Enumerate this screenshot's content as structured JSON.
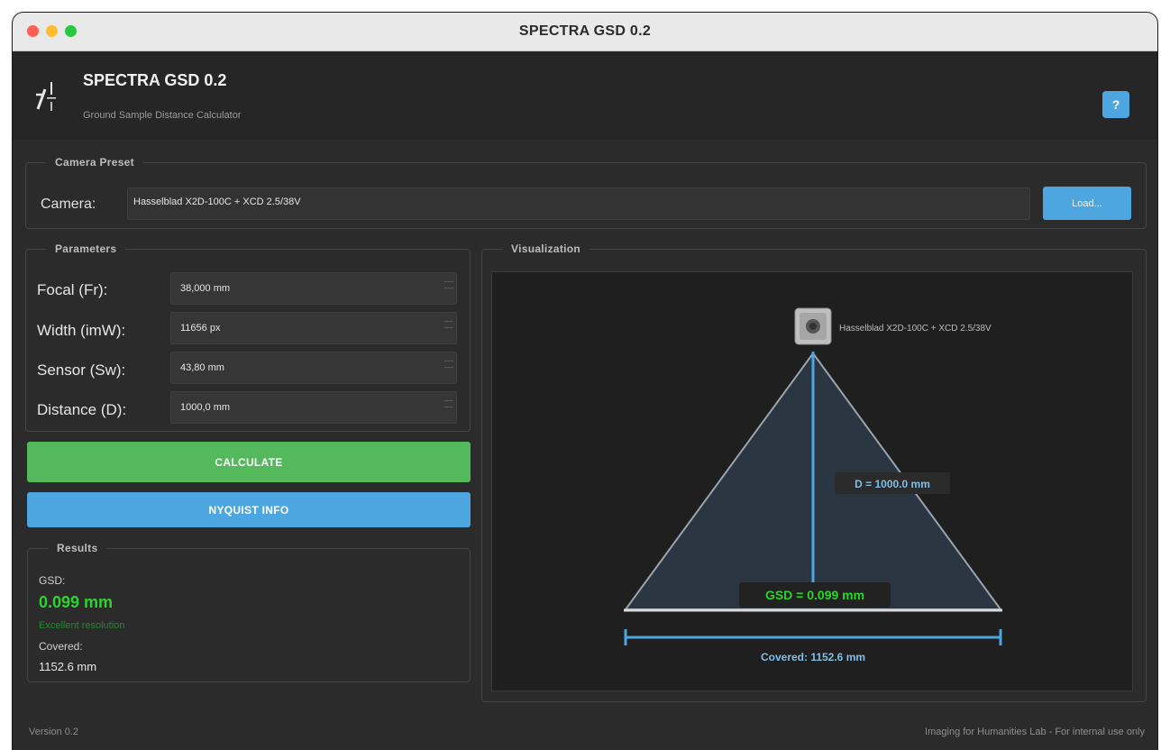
{
  "window": {
    "title": "SPECTRA GSD 0.2"
  },
  "header": {
    "app_name": "SPECTRA GSD 0.2",
    "subtitle": "Ground Sample Distance Calculator",
    "help_label": "?"
  },
  "camera_preset": {
    "group_title": "Camera Preset",
    "label": "Camera:",
    "value": "Hasselblad X2D-100C + XCD 2.5/38V",
    "load_label": "Load..."
  },
  "parameters": {
    "group_title": "Parameters",
    "fields": [
      {
        "label": "Focal (Fr):",
        "value": "38,000 mm"
      },
      {
        "label": "Width (imW):",
        "value": "11656 px"
      },
      {
        "label": "Sensor (Sw):",
        "value": "43,80 mm"
      },
      {
        "label": "Distance (D):",
        "value": "1000,0 mm"
      }
    ]
  },
  "buttons": {
    "calculate": "CALCULATE",
    "nyquist": "NYQUIST INFO"
  },
  "results": {
    "group_title": "Results",
    "gsd_label": "GSD:",
    "gsd_value": "0.099 mm",
    "quality": "Excellent resolution",
    "covered_label": "Covered:",
    "covered_value": "1152.6 mm"
  },
  "visualization": {
    "group_title": "Visualization",
    "camera_name": "Hasselblad X2D-100C + XCD 2.5/38V",
    "distance_label": "D = 1000.0 mm",
    "gsd_label": "GSD = 0.099 mm",
    "covered_label": "Covered: 1152.6 mm"
  },
  "footer": {
    "version": "Version 0.2",
    "credit": "Imaging for Humanities Lab - For internal use only"
  },
  "colors": {
    "accent_blue": "#4ea6e0",
    "accent_green": "#54b85c",
    "gsd_green": "#2fd12f"
  }
}
